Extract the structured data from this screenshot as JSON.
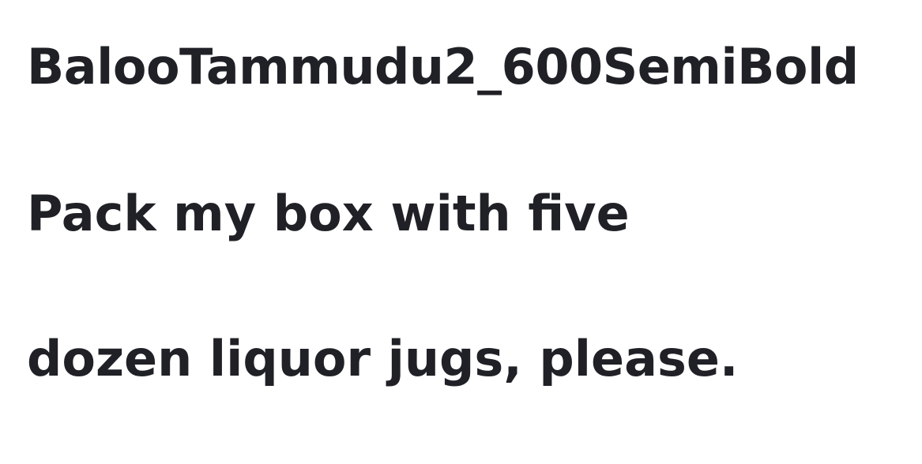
{
  "sample": {
    "font_label": "BalooTammudu2_600SemiBold",
    "lines": [
      "Pack my box with five",
      "dozen liquor jugs, please."
    ]
  },
  "colors": {
    "background": "#ffffff",
    "text": "#1f2126"
  }
}
